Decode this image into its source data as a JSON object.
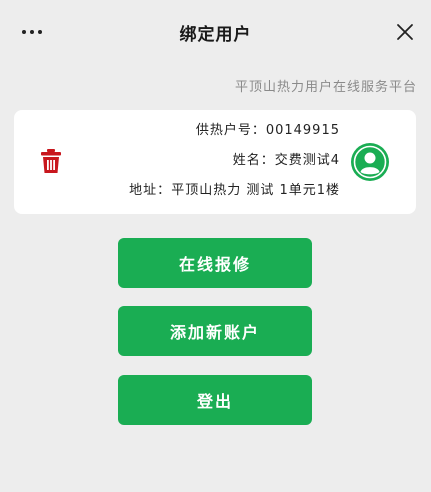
{
  "header": {
    "title": "绑定用户",
    "more_icon": "more-dots-icon",
    "close_icon": "close-icon"
  },
  "platform_name": "平顶山热力用户在线服务平台",
  "account": {
    "account_no_label": "供热户号：",
    "account_no": "00149915",
    "name_label": "姓名：",
    "name": "交费测试4",
    "address_label": "地址：",
    "address": "平顶山热力 测试 1单元1楼"
  },
  "actions": {
    "repair_label": "在线报修",
    "add_account_label": "添加新账户",
    "logout_label": "登出"
  },
  "colors": {
    "primary_green": "#1aad53",
    "delete_red": "#c8161d",
    "avatar_green": "#1aad53"
  }
}
